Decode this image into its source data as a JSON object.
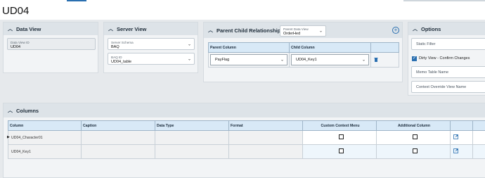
{
  "page": {
    "title": "UD04"
  },
  "data_view": {
    "header": "Data View",
    "id_label": "Data View ID",
    "id_value": "UD04"
  },
  "server_view": {
    "header": "Server View",
    "schema_label": "Server Schema",
    "schema_value": "BAQ",
    "baq_label": "BAQ ID",
    "baq_value": "UD04_table"
  },
  "pcr": {
    "header": "Parent Child Relationships",
    "pdv_label": "Parent Data View",
    "pdv_value": "OrderHed",
    "col_parent": "Parent Column",
    "col_child": "Child Column",
    "row_parent": "PayFlag",
    "row_child": "UD04_Key1"
  },
  "options": {
    "header": "Options",
    "static_filter": "Static Filter",
    "dirty_view": "Dirty View - Confirm Changes",
    "memo_table": "Memo Table Name",
    "context_override": "Context Override View Name"
  },
  "columns": {
    "header": "Columns",
    "headers": [
      "Column",
      "Caption",
      "Data Type",
      "Format",
      "Custom Context Menu",
      "Additional Column"
    ],
    "rows": [
      {
        "column": "UD04_Character01"
      },
      {
        "column": "UD04_Key1"
      }
    ]
  },
  "colors": {
    "accent": "#2a6fb0",
    "header_bg": "#dde3e8",
    "grid_header": "#d8e9f7"
  },
  "icons": [
    "chevron-up-icon",
    "add-icon",
    "delete-icon",
    "open-external-icon",
    "checkbox-checked-icon",
    "dropdown-caret-icon"
  ]
}
